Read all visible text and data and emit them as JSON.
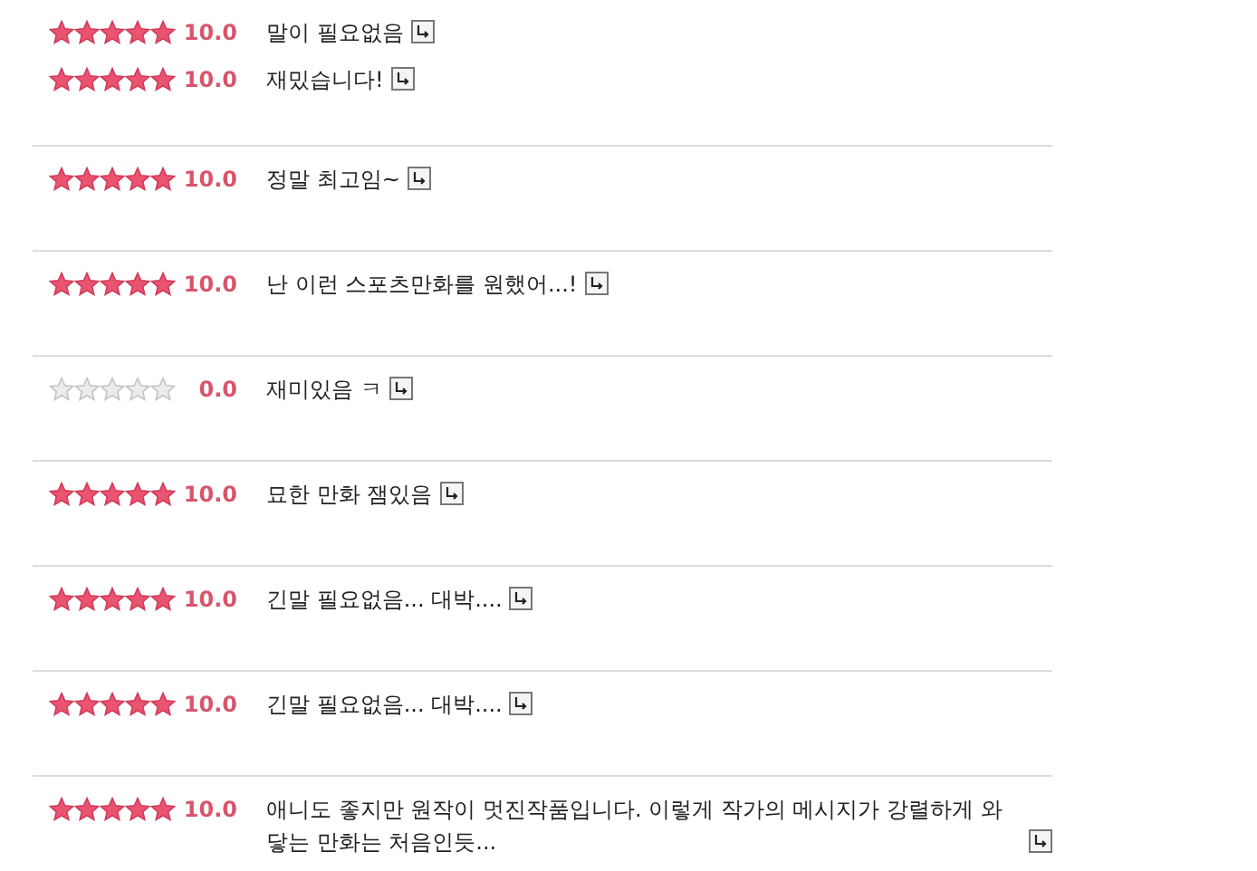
{
  "review_groups": [
    {
      "reviews": [
        {
          "stars": 5,
          "score": "10.0",
          "comment": "말이 필요없음"
        },
        {
          "stars": 5,
          "score": "10.0",
          "comment": "재밌습니다!"
        }
      ]
    },
    {
      "reviews": [
        {
          "stars": 5,
          "score": "10.0",
          "comment": "정말 최고임~"
        }
      ]
    },
    {
      "reviews": [
        {
          "stars": 5,
          "score": "10.0",
          "comment": "난 이런 스포츠만화를 원했어...!"
        }
      ]
    },
    {
      "reviews": [
        {
          "stars": 0,
          "score": "0.0",
          "comment": "재미있음 ㅋ"
        }
      ]
    },
    {
      "reviews": [
        {
          "stars": 5,
          "score": "10.0",
          "comment": "묘한 만화 잼있음"
        }
      ]
    },
    {
      "reviews": [
        {
          "stars": 5,
          "score": "10.0",
          "comment": "긴말 필요없음... 대박...."
        }
      ]
    },
    {
      "reviews": [
        {
          "stars": 5,
          "score": "10.0",
          "comment": "긴말 필요없음... 대박...."
        }
      ]
    },
    {
      "reviews": [
        {
          "stars": 5,
          "score": "10.0",
          "comment": "애니도 좋지만 원작이 멋진작품입니다. 이렇게 작가의 메시지가 강렬하게 와닿는 만화는 처음인듯..."
        }
      ]
    }
  ]
}
